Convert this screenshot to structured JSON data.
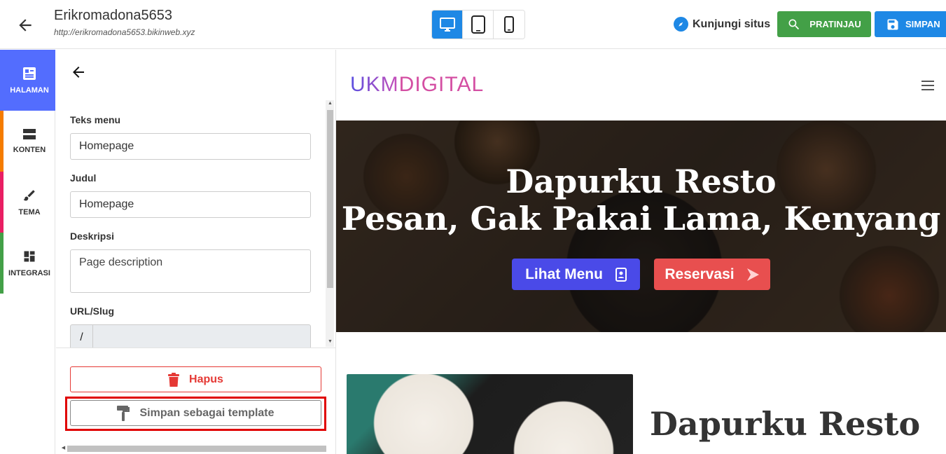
{
  "header": {
    "site_name": "Erikromadona5653",
    "site_url": "http://erikromadona5653.bikinweb.xyz",
    "devices": [
      "desktop-icon",
      "tablet-icon",
      "mobile-icon"
    ],
    "active_device": "desktop",
    "visit_label": "Kunjungi situs",
    "preview_label": "PRATINJAU",
    "save_label": "SIMPAN"
  },
  "sidebar": {
    "items": [
      {
        "label": "HALAMAN",
        "icon": "page-icon",
        "color": "#536dfe"
      },
      {
        "label": "KONTEN",
        "icon": "content-icon",
        "color": "#f57c00"
      },
      {
        "label": "TEMA",
        "icon": "brush-icon",
        "color": "#e91e63"
      },
      {
        "label": "INTEGRASI",
        "icon": "dashboard-icon",
        "color": "#43a047"
      }
    ]
  },
  "panel": {
    "menu_text_label": "Teks menu",
    "menu_text_value": "Homepage",
    "title_label": "Judul",
    "title_value": "Homepage",
    "description_label": "Deskripsi",
    "description_placeholder": "Page description",
    "slug_label": "URL/Slug",
    "slug_prefix": "/",
    "delete_label": "Hapus",
    "save_template_label": "Simpan sebagai template"
  },
  "preview": {
    "logo_ukm": "UKM",
    "logo_digital": "DIGITAL",
    "hero_line1": "Dapurku Resto",
    "hero_line2": "Pesan, Gak Pakai Lama, Kenyang",
    "menu_button": "Lihat Menu",
    "reserve_button": "Reservasi",
    "section_title": "Dapurku Resto"
  },
  "colors": {
    "primary": "#1e88e5",
    "success": "#43a047",
    "danger": "#e53935",
    "highlight": "#e00000"
  }
}
